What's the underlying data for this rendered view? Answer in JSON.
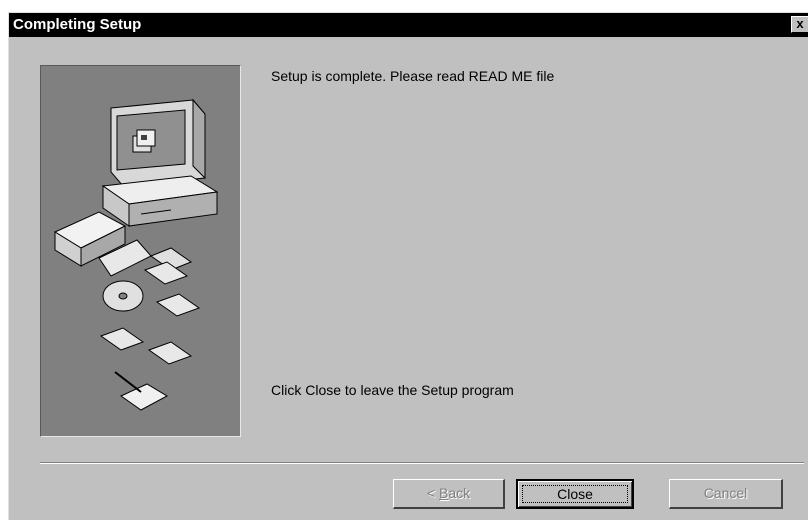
{
  "window": {
    "title": "Completing Setup",
    "close_glyph": "x"
  },
  "content": {
    "message_top": "Setup is complete.  Please read READ ME file",
    "message_bottom": "Click Close to leave the Setup program"
  },
  "buttons": {
    "back": {
      "prefix": "< ",
      "accel": "B",
      "rest": "ack",
      "enabled": false
    },
    "close": {
      "label": "Close",
      "enabled": true,
      "default": true
    },
    "cancel": {
      "label": "Cancel",
      "enabled": false
    }
  },
  "illustration": {
    "subject": "computer-with-install-media",
    "items": [
      "monitor-icon",
      "system-unit-icon",
      "open-box-icon",
      "floppy-disk-icon",
      "cd-rom-icon",
      "document-with-pen-icon"
    ]
  },
  "colors": {
    "title_bar": "#000000",
    "dialog_face": "#c0c0c0",
    "illustration_bg": "#808080",
    "disabled_text": "#808080"
  }
}
